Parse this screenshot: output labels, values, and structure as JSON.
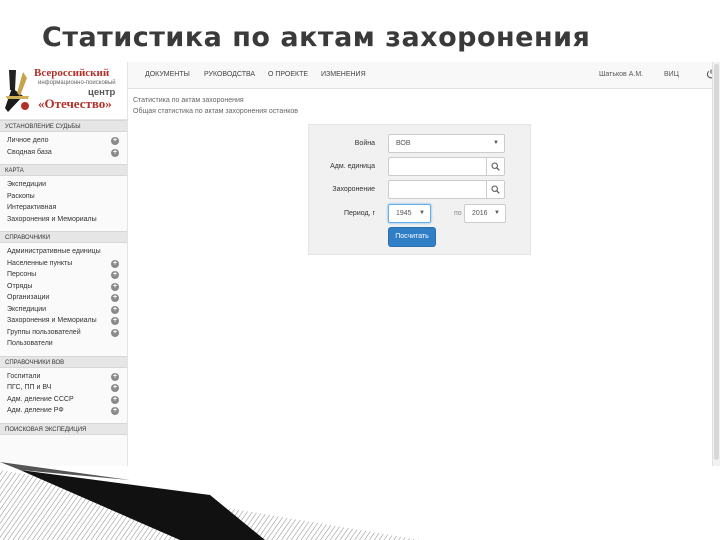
{
  "slide": {
    "title": "Статистика по актам захоронения"
  },
  "logo": {
    "line1": "Всероссийский",
    "line2": "информационно-поисковый",
    "line3": "центр",
    "line4": "«Отечество»"
  },
  "sidebar": {
    "sections": [
      {
        "header": "УСТАНОВЛЕНИЕ СУДЬБЫ",
        "items": [
          {
            "label": "Личное дело",
            "plus": true
          },
          {
            "label": "Сводная база",
            "plus": true
          }
        ]
      },
      {
        "header": "КАРТА",
        "items": [
          {
            "label": "Экспедиции",
            "plus": false
          },
          {
            "label": "Раскопы",
            "plus": false
          },
          {
            "label": "Интерактивная",
            "plus": false
          },
          {
            "label": "Захоронения и Мемориалы",
            "plus": false
          }
        ]
      },
      {
        "header": "СПРАВОЧНИКИ",
        "items": [
          {
            "label": "Административные единицы",
            "plus": false
          },
          {
            "label": "Населенные пункты",
            "plus": true
          },
          {
            "label": "Персоны",
            "plus": true
          },
          {
            "label": "Отряды",
            "plus": true
          },
          {
            "label": "Организации",
            "plus": true
          },
          {
            "label": "Экспедиции",
            "plus": true
          },
          {
            "label": "Захоронения и Мемориалы",
            "plus": true
          },
          {
            "label": "Группы пользователей",
            "plus": true
          },
          {
            "label": "Пользователи",
            "plus": false
          }
        ]
      },
      {
        "header": "СПРАВОЧНИКИ ВОВ",
        "items": [
          {
            "label": "Госпитали",
            "plus": true
          },
          {
            "label": "ПГС, ПП и ВЧ",
            "plus": true
          },
          {
            "label": "Адм. деление СССР",
            "plus": true
          },
          {
            "label": "Адм. деление РФ",
            "plus": true
          }
        ]
      },
      {
        "header": "ПОИСКОВАЯ ЭКСПЕДИЦИЯ",
        "items": []
      }
    ]
  },
  "topnav": {
    "items": [
      "ДОКУМЕНТЫ",
      "РУКОВОДСТВА",
      "О ПРОЕКТЕ",
      "ИЗМЕНЕНИЯ"
    ],
    "user": "Шатьков А.М.",
    "org": "ВИЦ"
  },
  "breadcrumb": {
    "line1": "Статистика по актам захоронения",
    "line2": "Общая статистика по актам захоронения останков"
  },
  "form": {
    "war_label": "Война",
    "war_value": "ВОВ",
    "adm_label": "Адм. единица",
    "burial_label": "Захоронение",
    "period_label": "Период, г",
    "year_from": "1945",
    "year_to_prefix": "по",
    "year_to": "2016",
    "submit": "Посчитать"
  },
  "icons": {
    "search": "search-icon",
    "power": "power-icon",
    "plus": "plus-circle-icon",
    "caret": "caret-down-icon"
  },
  "colors": {
    "brand_red": "#b0302a",
    "primary_button": "#2f7ec6"
  }
}
